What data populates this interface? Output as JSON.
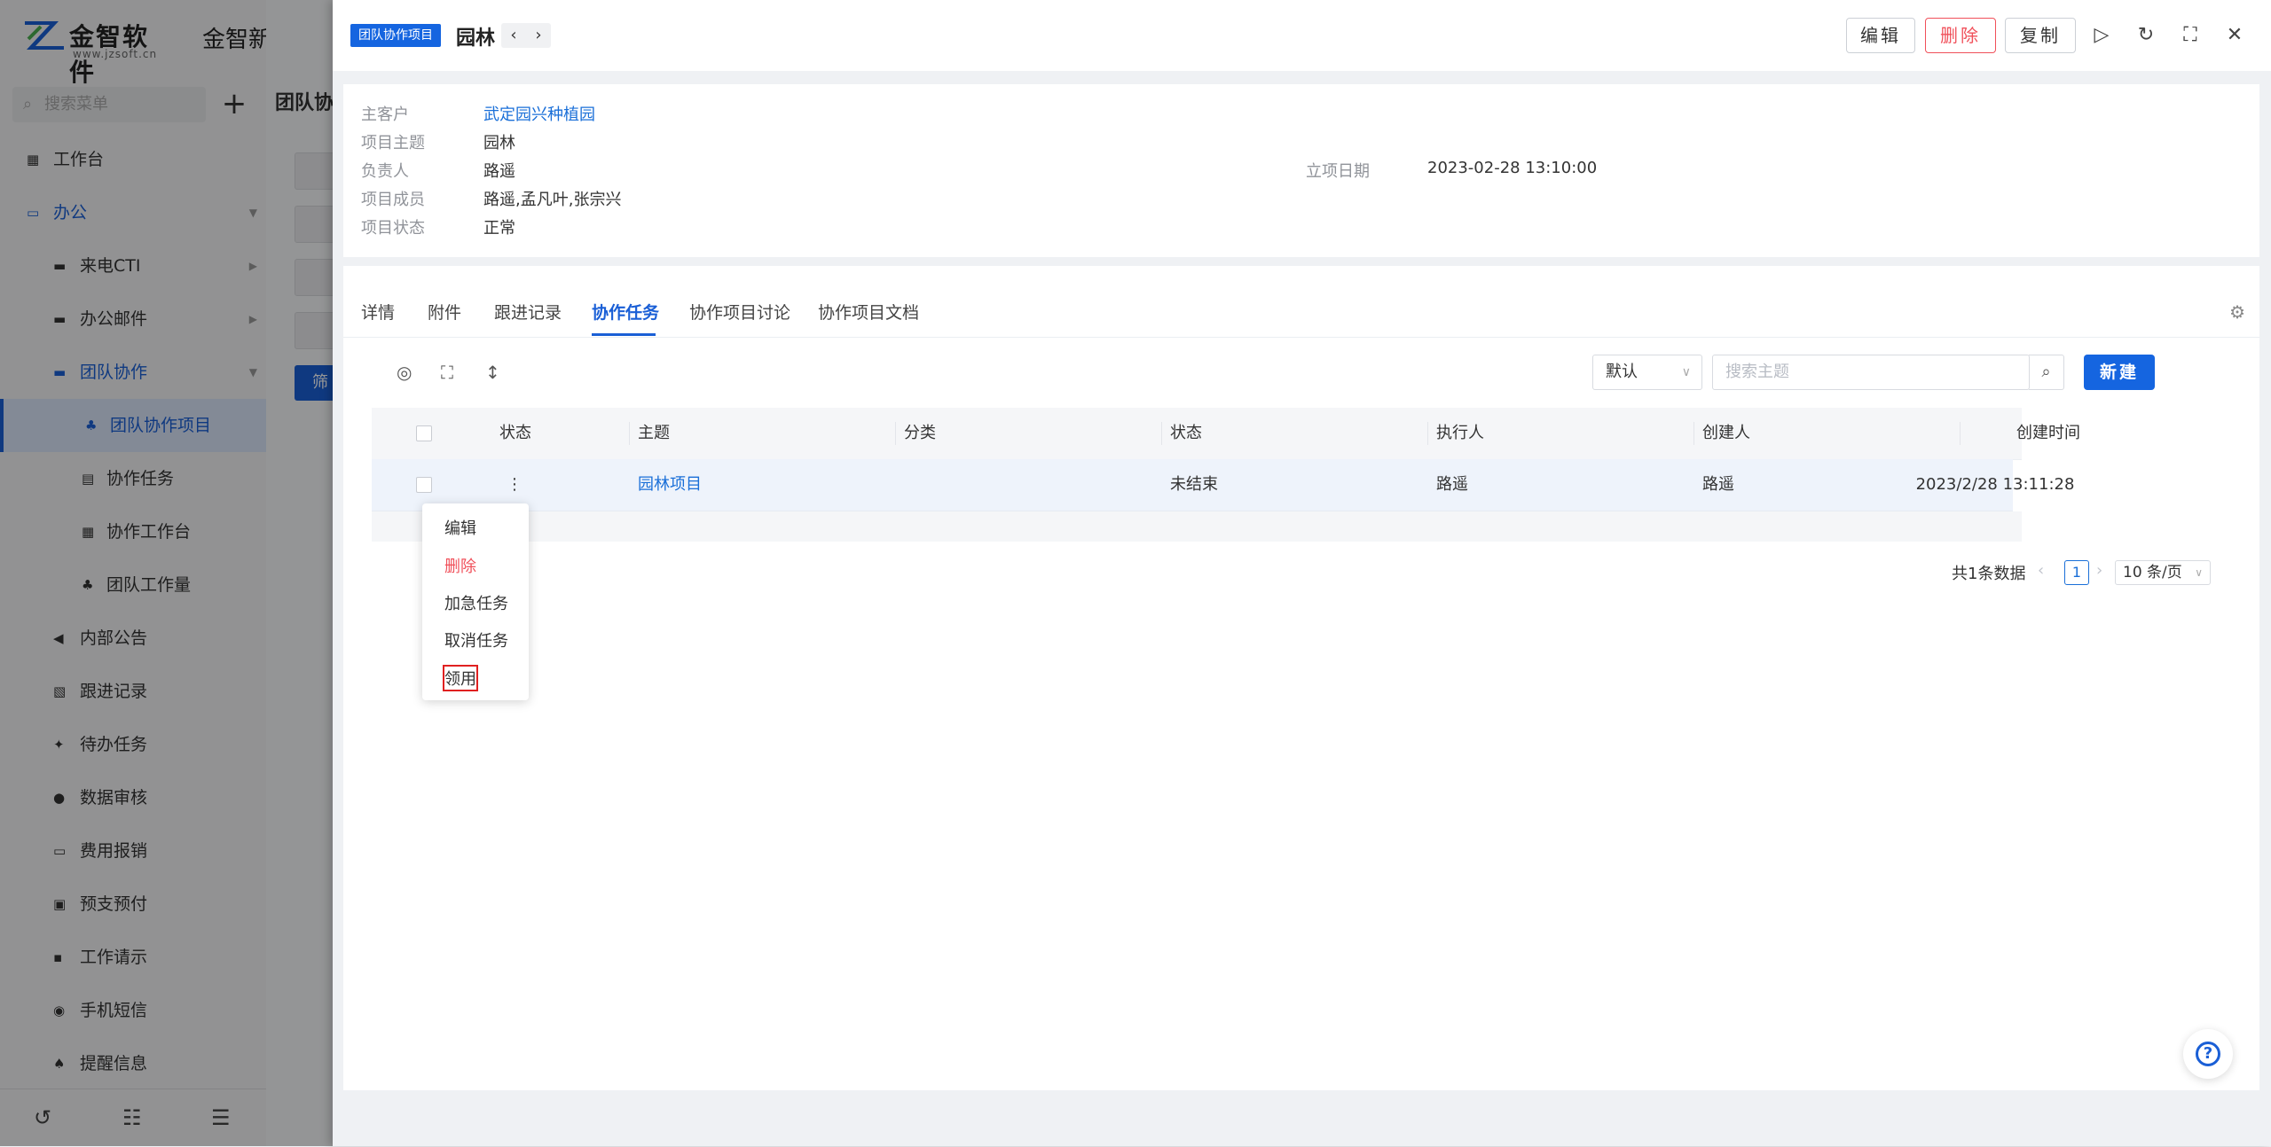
{
  "app": {
    "logo_text": "金智软件",
    "logo_sub": "www.jzsoft.cn",
    "title": "金智新版测试公"
  },
  "sidebar": {
    "search_placeholder": "搜索菜单",
    "items": [
      {
        "label": "工作台",
        "icon": "dashboard-icon"
      },
      {
        "label": "办公",
        "icon": "office-icon"
      },
      {
        "label": "来电CTI",
        "icon": "folder-icon"
      },
      {
        "label": "办公邮件",
        "icon": "folder-icon"
      },
      {
        "label": "团队协作",
        "icon": "folder-icon"
      },
      {
        "label": "团队协作项目",
        "icon": "team-icon"
      },
      {
        "label": "协作任务",
        "icon": "task-icon"
      },
      {
        "label": "协作工作台",
        "icon": "dashboard-icon"
      },
      {
        "label": "团队工作量",
        "icon": "team-icon"
      },
      {
        "label": "内部公告",
        "icon": "announcement-icon"
      },
      {
        "label": "跟进记录",
        "icon": "record-icon"
      },
      {
        "label": "待办任务",
        "icon": "pin-icon"
      },
      {
        "label": "数据审核",
        "icon": "user-icon"
      },
      {
        "label": "费用报销",
        "icon": "receipt-icon"
      },
      {
        "label": "预支预付",
        "icon": "payment-icon"
      },
      {
        "label": "工作请示",
        "icon": "request-icon"
      },
      {
        "label": "手机短信",
        "icon": "sms-icon"
      },
      {
        "label": "提醒信息",
        "icon": "bell-icon"
      }
    ]
  },
  "background": {
    "heading": "团队协",
    "filter_button": "筛"
  },
  "drawer": {
    "tag": "团队协作项目",
    "title": "园林",
    "buttons": {
      "edit": "编辑",
      "delete": "删除",
      "copy": "复制"
    },
    "info": {
      "customer_label": "主客户",
      "customer": "武定园兴种植园",
      "subject_label": "项目主题",
      "subject": "园林",
      "owner_label": "负责人",
      "owner": "路遥",
      "members_label": "项目成员",
      "members": "路遥,孟凡叶,张宗兴",
      "status_label": "项目状态",
      "status": "正常",
      "date_label": "立项日期",
      "date": "2023-02-28 13:10:00"
    },
    "tabs": [
      "详情",
      "附件",
      "跟进记录",
      "协作任务",
      "协作项目讨论",
      "协作项目文档"
    ],
    "toolbar": {
      "sort_select": "默认",
      "search_placeholder": "搜索主题",
      "new_button": "新建"
    },
    "table": {
      "columns": [
        "状态",
        "主题",
        "分类",
        "状态",
        "执行人",
        "创建人",
        "创建时间"
      ],
      "rows": [
        {
          "subject": "园林项目",
          "category": "",
          "status": "未结束",
          "executor": "路遥",
          "creator": "路遥",
          "created": "2023/2/28 13:11:28"
        }
      ]
    },
    "pager": {
      "total": "共1条数据",
      "current": "1",
      "size": "10 条/页"
    },
    "context_menu": [
      "编辑",
      "删除",
      "加急任务",
      "取消任务",
      "领用"
    ]
  },
  "colors": {
    "accent": "#1565e0",
    "danger": "#f0505a"
  }
}
